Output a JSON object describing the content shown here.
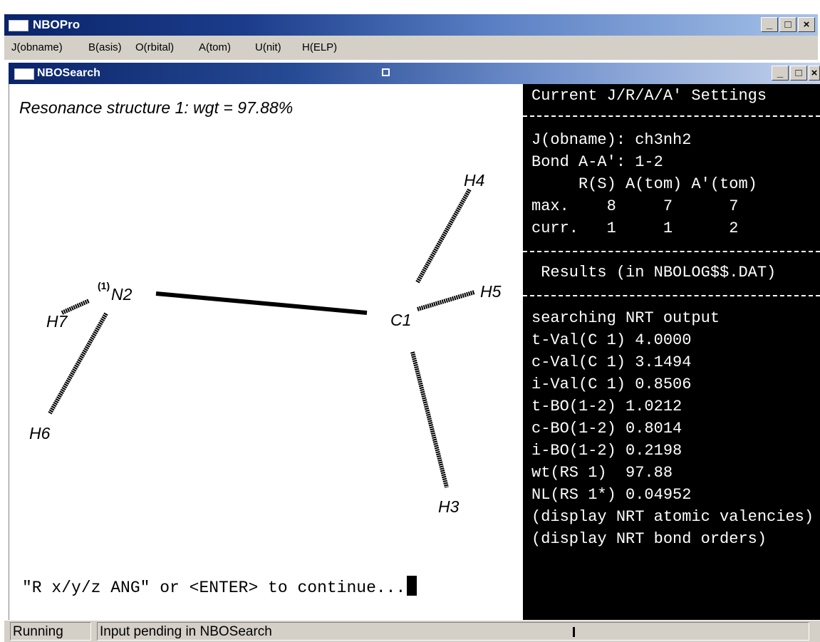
{
  "app": {
    "title": "NBOPro"
  },
  "caption_buttons": [
    "_",
    "□",
    "×"
  ],
  "menu": [
    {
      "label": "J(obname)"
    },
    {
      "label": "B(asis)"
    },
    {
      "label": "O(rbital)"
    },
    {
      "label": "A(tom)"
    },
    {
      "label": "U(nit)"
    },
    {
      "label": "H(ELP)"
    }
  ],
  "child_window": {
    "title": "NBOSearch"
  },
  "structure": {
    "title": "Resonance structure 1: wgt = 97.88%",
    "atoms": {
      "N2_sup": "(1)",
      "N2": "N2",
      "C1": "C1",
      "H3": "H3",
      "H4": "H4",
      "H5": "H5",
      "H6": "H6",
      "H7": "H7"
    }
  },
  "prompt": {
    "text": "\"R x/y/z ANG\" or <ENTER> to continue..."
  },
  "settings_panel": {
    "title": "Current J/R/A/A' Settings",
    "jobname": "J(obname): ch3nh2",
    "bond": "Bond A-A': 1-2",
    "header": "     R(S) A(tom) A'(tom)",
    "max_row": "max.    8     7      7",
    "curr_row": "curr.   1     1      2",
    "results_title": " Results (in NBOLOG$$.DAT)",
    "output": [
      "searching NRT output",
      "t-Val(C 1) 4.0000",
      "c-Val(C 1) 3.1494",
      "i-Val(C 1) 0.8506",
      "t-BO(1-2) 1.0212",
      "c-BO(1-2) 0.8014",
      "i-BO(1-2) 0.2198",
      "wt(RS 1)  97.88",
      "NL(RS 1*) 0.04952",
      "(display NRT atomic valencies)",
      "(display NRT bond orders)"
    ]
  },
  "status": {
    "state": "Running",
    "message": "Input pending in NBOSearch"
  }
}
